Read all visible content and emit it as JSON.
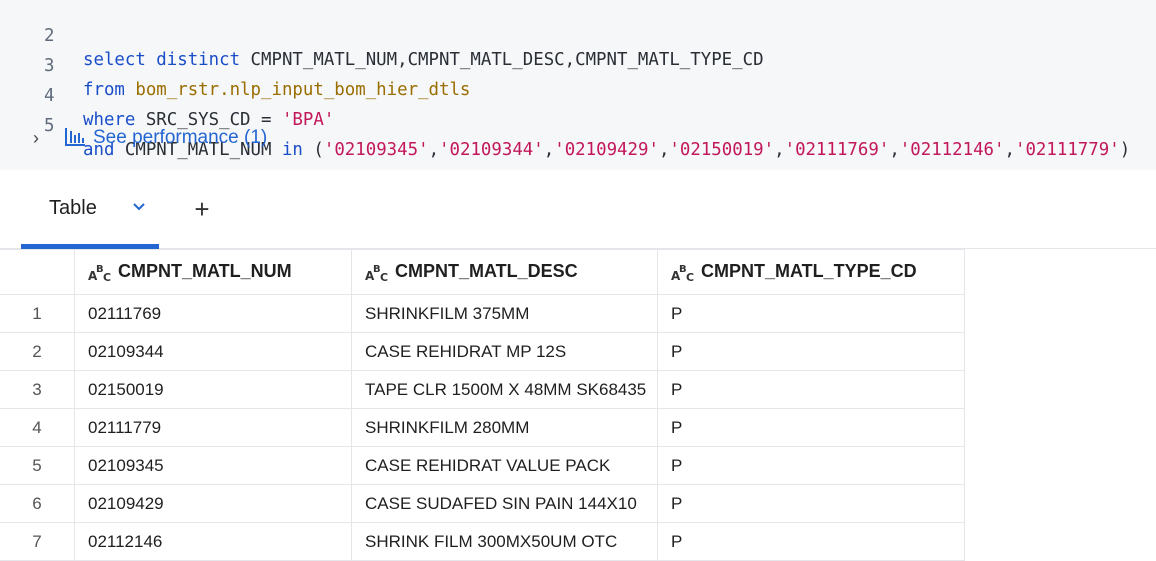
{
  "editor": {
    "lines": [
      {
        "num": "2",
        "tokens": [
          {
            "t": "select distinct ",
            "c": "kw"
          },
          {
            "t": "CMPNT_MATL_NUM,CMPNT_MATL_DESC,CMPNT_MATL_TYPE_CD",
            "c": "id"
          }
        ]
      },
      {
        "num": "3",
        "tokens": [
          {
            "t": "from ",
            "c": "kw"
          },
          {
            "t": "bom_rstr.nlp_input_bom_hier_dtls",
            "c": "fn"
          }
        ]
      },
      {
        "num": "4",
        "tokens": [
          {
            "t": "where ",
            "c": "kw"
          },
          {
            "t": "SRC_SYS_CD = ",
            "c": "id"
          },
          {
            "t": "'BPA'",
            "c": "str"
          }
        ]
      },
      {
        "num": "5",
        "tokens": [
          {
            "t": "and ",
            "c": "kw"
          },
          {
            "t": "CMPNT_MATL_NUM ",
            "c": "id"
          },
          {
            "t": "in ",
            "c": "kw"
          },
          {
            "t": "(",
            "c": "id"
          },
          {
            "t": "'02109345'",
            "c": "str"
          },
          {
            "t": ",",
            "c": "id"
          },
          {
            "t": "'02109344'",
            "c": "str"
          },
          {
            "t": ",",
            "c": "id"
          },
          {
            "t": "'02109429'",
            "c": "str"
          },
          {
            "t": ",",
            "c": "id"
          },
          {
            "t": "'02150019'",
            "c": "str"
          },
          {
            "t": ",",
            "c": "id"
          },
          {
            "t": "'02111769'",
            "c": "str"
          },
          {
            "t": ",",
            "c": "id"
          },
          {
            "t": "'02112146'",
            "c": "str"
          },
          {
            "t": ",",
            "c": "id"
          },
          {
            "t": "'02111779'",
            "c": "str"
          },
          {
            "t": ")",
            "c": "id"
          }
        ]
      }
    ],
    "performance_label": "See performance (1)"
  },
  "tabs": {
    "table_label": "Table",
    "add_label": "+"
  },
  "table": {
    "columns": [
      "CMPNT_MATL_NUM",
      "CMPNT_MATL_DESC",
      "CMPNT_MATL_TYPE_CD"
    ],
    "rows": [
      {
        "n": "1",
        "cells": [
          "02111769",
          "SHRINKFILM 375MM",
          "P"
        ]
      },
      {
        "n": "2",
        "cells": [
          "02109344",
          "CASE REHIDRAT MP 12S",
          "P"
        ]
      },
      {
        "n": "3",
        "cells": [
          "02150019",
          "TAPE CLR 1500M X 48MM SK68435",
          "P"
        ]
      },
      {
        "n": "4",
        "cells": [
          "02111779",
          "SHRINKFILM 280MM",
          "P"
        ]
      },
      {
        "n": "5",
        "cells": [
          "02109345",
          "CASE REHIDRAT VALUE PACK",
          "P"
        ]
      },
      {
        "n": "6",
        "cells": [
          "02109429",
          "CASE SUDAFED SIN PAIN 144X10",
          "P"
        ]
      },
      {
        "n": "7",
        "cells": [
          "02112146",
          "SHRINK FILM 300MX50UM OTC",
          "P"
        ]
      }
    ]
  },
  "colors": {
    "accent": "#2366d1",
    "keyword": "#1a4ec9",
    "string": "#c2185b",
    "function": "#9a6d00"
  }
}
